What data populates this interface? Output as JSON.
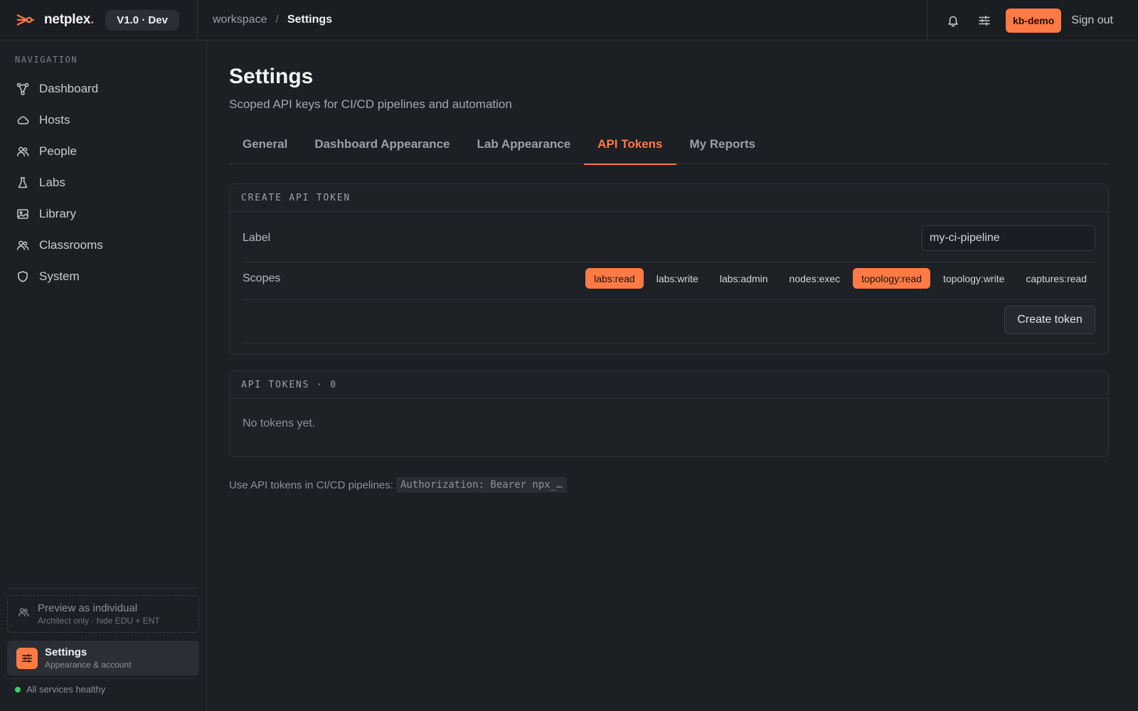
{
  "topbar": {
    "brand_name": "netplex",
    "brand_dot": ".",
    "version": "V1.0 · Dev",
    "breadcrumb_root": "workspace",
    "breadcrumb_sep": "/",
    "breadcrumb_current": "Settings",
    "user": "kb-demo",
    "signout": "Sign out"
  },
  "sidebar": {
    "heading": "NAVIGATION",
    "items": [
      {
        "label": "Dashboard",
        "icon": "topology-icon"
      },
      {
        "label": "Hosts",
        "icon": "cloud-icon"
      },
      {
        "label": "People",
        "icon": "people-icon"
      },
      {
        "label": "Labs",
        "icon": "flask-icon"
      },
      {
        "label": "Library",
        "icon": "image-icon"
      },
      {
        "label": "Classrooms",
        "icon": "people-icon"
      },
      {
        "label": "System",
        "icon": "shield-icon"
      }
    ],
    "preview": {
      "title": "Preview as individual",
      "subtitle": "Architect only · hide EDU + ENT"
    },
    "settings": {
      "title": "Settings",
      "subtitle": "Appearance & account"
    },
    "status": "All services healthy"
  },
  "main": {
    "title": "Settings",
    "subtitle": "Scoped API keys for CI/CD pipelines and automation",
    "tabs": [
      {
        "label": "General",
        "active": false
      },
      {
        "label": "Dashboard Appearance",
        "active": false
      },
      {
        "label": "Lab Appearance",
        "active": false
      },
      {
        "label": "API Tokens",
        "active": true
      },
      {
        "label": "My Reports",
        "active": false
      }
    ],
    "create_card": {
      "heading": "CREATE API TOKEN",
      "label_field": "Label",
      "label_value": "my-ci-pipeline",
      "scopes_label": "Scopes",
      "scopes": [
        {
          "label": "labs:read",
          "selected": true
        },
        {
          "label": "labs:write",
          "selected": false
        },
        {
          "label": "labs:admin",
          "selected": false
        },
        {
          "label": "nodes:exec",
          "selected": false
        },
        {
          "label": "topology:read",
          "selected": true
        },
        {
          "label": "topology:write",
          "selected": false
        },
        {
          "label": "captures:read",
          "selected": false
        }
      ],
      "create_button": "Create token"
    },
    "tokens_card": {
      "heading": "API TOKENS · 0",
      "empty": "No tokens yet."
    },
    "footnote": "Use API tokens in CI/CD pipelines:",
    "footnote_code": "Authorization: Bearer npx_…"
  },
  "colors": {
    "accent": "#ff7a45",
    "status_ok": "#3ecf72",
    "background": "#1c1f24"
  }
}
